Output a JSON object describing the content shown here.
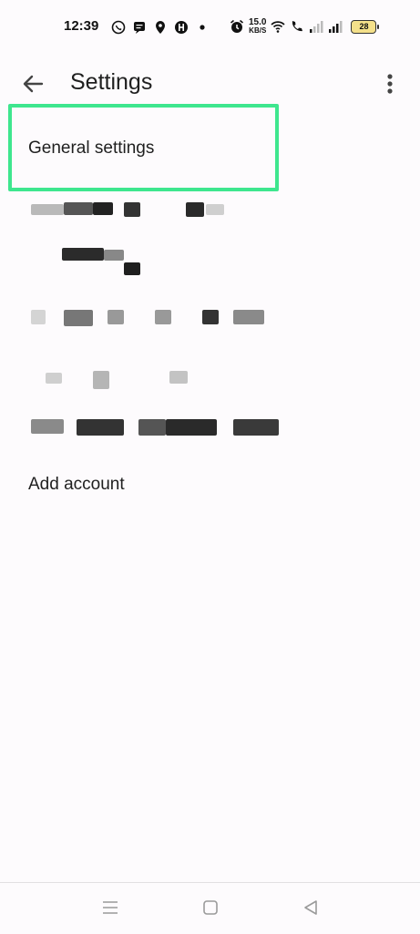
{
  "status_bar": {
    "time": "12:39",
    "net_speed_value": "15.0",
    "net_speed_unit": "KB/S",
    "battery": "28"
  },
  "app_bar": {
    "title": "Settings"
  },
  "settings": {
    "general_label": "General settings",
    "add_account_label": "Add account"
  },
  "colors": {
    "highlight": "#3ee68e",
    "background": "#fdfbfd"
  },
  "icons": {
    "back": "arrow-left-icon",
    "more": "more-vert-icon",
    "nav_recents": "menu-icon",
    "nav_home": "square-icon",
    "nav_back": "triangle-back-icon"
  }
}
